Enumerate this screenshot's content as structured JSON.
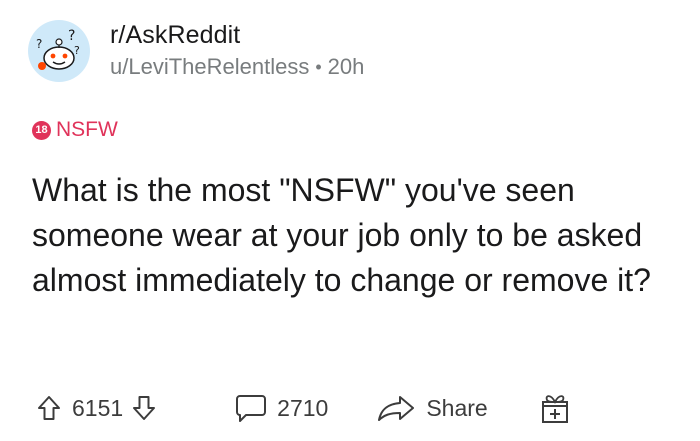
{
  "post": {
    "subreddit": "r/AskReddit",
    "author": "u/LeviTheRelentless",
    "separator": "•",
    "time": "20h",
    "nsfw_badge_number": "18",
    "nsfw_label": "NSFW",
    "title": "What is the most \"NSFW\" you've seen someone wear at your job only to be asked almost immediately to change or remove it?"
  },
  "actions": {
    "upvote_count": "6151",
    "comment_count": "2710",
    "share_label": "Share"
  },
  "icons": {
    "avatar": "snoo-question-avatar",
    "upvote": "arrow-up-icon",
    "downvote": "arrow-down-icon",
    "comment": "comment-bubble-icon",
    "share": "share-arrow-icon",
    "award": "gift-award-icon"
  },
  "colors": {
    "nsfw": "#e0335a",
    "avatar_bg": "#cfe9f9",
    "meta_text": "#787c7e",
    "action_text": "#3c3c3c"
  }
}
